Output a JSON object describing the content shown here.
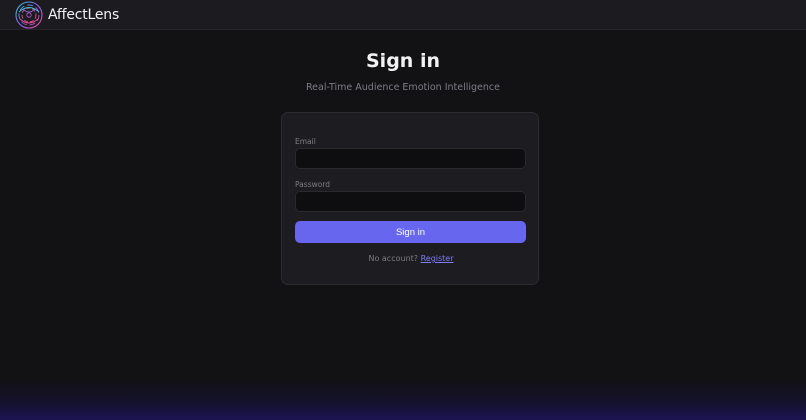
{
  "app": {
    "name": "AffectLens",
    "logo_icon": "affectlens-logo-icon"
  },
  "auth": {
    "title": "Sign in",
    "subtitle": "Real-Time Audience Emotion Intelligence",
    "email": {
      "label": "Email",
      "value": "",
      "placeholder": ""
    },
    "password": {
      "label": "Password",
      "value": "",
      "placeholder": ""
    },
    "submit_label": "Sign in",
    "register_prompt": "No account?",
    "register_link": "Register"
  },
  "colors": {
    "background": "#121114",
    "topbar": "#1c1b20",
    "card": "#1d1c21",
    "accent": "#6667ee",
    "link": "#7f7df5",
    "muted_text": "#7e7d85"
  }
}
